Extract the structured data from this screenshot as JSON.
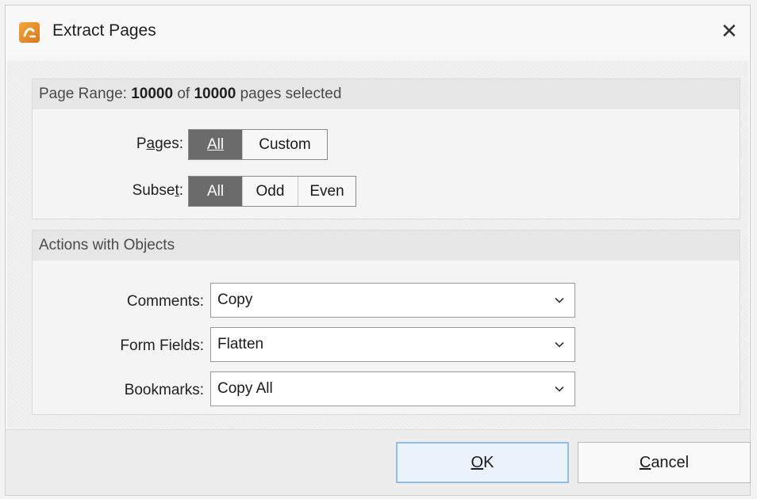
{
  "window": {
    "title": "Extract Pages",
    "close_glyph": "✕"
  },
  "page_range": {
    "prefix": "Page Range:",
    "selected": "10000",
    "of": "of",
    "total": "10000",
    "suffix": "pages selected",
    "pages_label_pre": "P",
    "pages_label_u": "a",
    "pages_label_post": "ges:",
    "pages_options": [
      "All",
      "Custom"
    ],
    "pages_selected": "All",
    "subset_label_pre": "Subse",
    "subset_label_u": "t",
    "subset_label_post": ":",
    "subset_options": [
      "All",
      "Odd",
      "Even"
    ],
    "subset_selected": "All"
  },
  "actions": {
    "header": "Actions with Objects",
    "comments_label": "Comments:",
    "comments_value": "Copy",
    "form_fields_label": "Form Fields:",
    "form_fields_value": "Flatten",
    "bookmarks_label": "Bookmarks:",
    "bookmarks_value": "Copy All"
  },
  "buttons": {
    "ok_u": "O",
    "ok_rest": "K",
    "cancel_u": "C",
    "cancel_rest": "ancel"
  },
  "icons": {
    "app": "extract-pages-app-icon",
    "close": "close-icon",
    "dropdown": "chevron-down-icon"
  },
  "colors": {
    "accent_segment": "#6b6b6b",
    "ok_border": "#8fbde6",
    "app_icon": "#e48a2a"
  }
}
